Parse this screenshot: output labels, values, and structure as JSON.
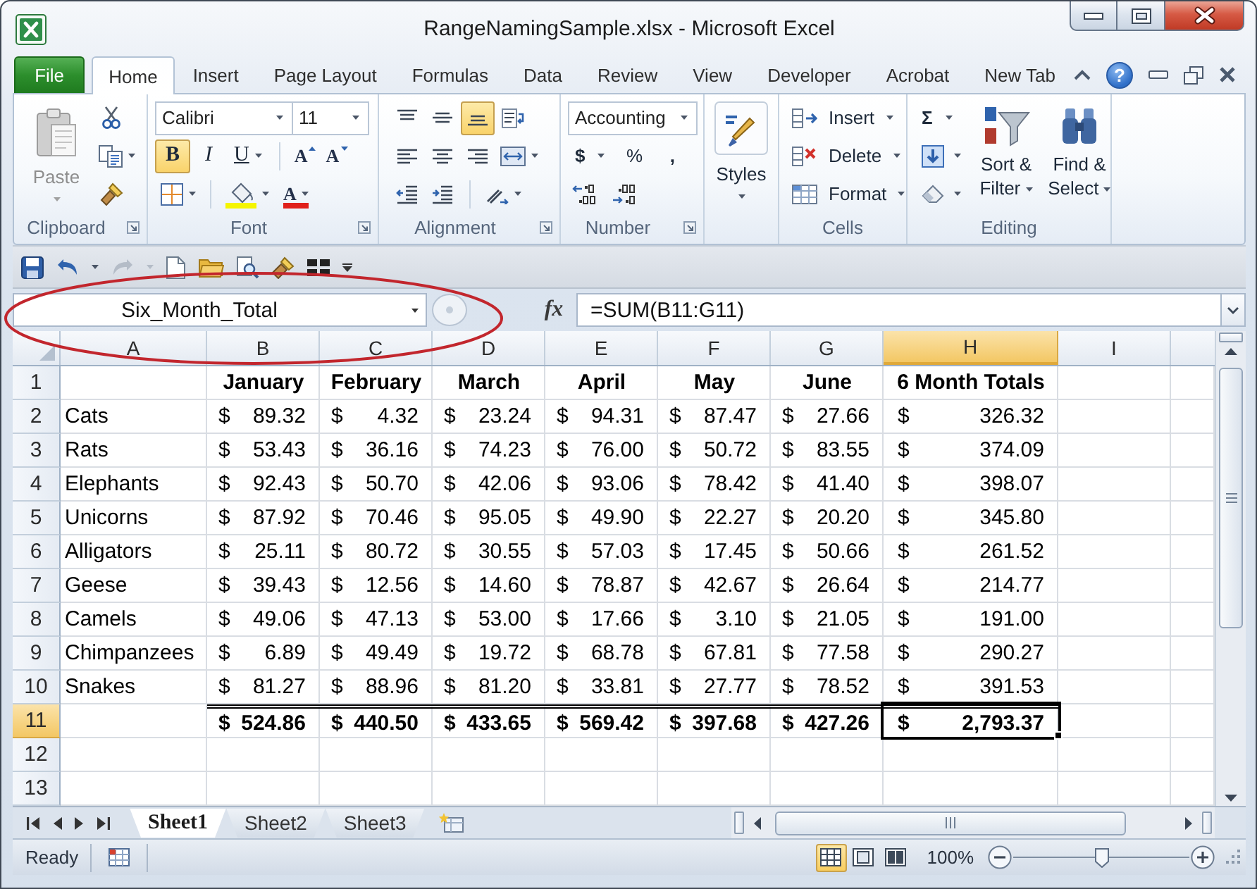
{
  "window": {
    "title": "RangeNamingSample.xlsx - Microsoft Excel"
  },
  "ribbon_tabs": [
    {
      "label": "File",
      "kind": "file",
      "selected": false
    },
    {
      "label": "Home",
      "kind": "tab",
      "selected": true
    },
    {
      "label": "Insert",
      "kind": "tab",
      "selected": false
    },
    {
      "label": "Page Layout",
      "kind": "tab",
      "selected": false
    },
    {
      "label": "Formulas",
      "kind": "tab",
      "selected": false
    },
    {
      "label": "Data",
      "kind": "tab",
      "selected": false
    },
    {
      "label": "Review",
      "kind": "tab",
      "selected": false
    },
    {
      "label": "View",
      "kind": "tab",
      "selected": false
    },
    {
      "label": "Developer",
      "kind": "tab",
      "selected": false
    },
    {
      "label": "Acrobat",
      "kind": "tab",
      "selected": false
    },
    {
      "label": "New Tab",
      "kind": "tab",
      "selected": false
    }
  ],
  "help": "?",
  "ribbon": {
    "clipboard": {
      "paste": {
        "label": "Paste",
        "disabled": true
      },
      "label": "Clipboard"
    },
    "font": {
      "name": "Calibri",
      "size": "11",
      "styles": [
        {
          "kind": "bold",
          "label": "B",
          "on": true
        },
        {
          "kind": "italic",
          "label": "I",
          "on": false
        },
        {
          "kind": "underline",
          "label": "U",
          "on": false
        }
      ],
      "grow": "A",
      "shrink": "A",
      "font_color": "A",
      "label": "Font"
    },
    "alignment": {
      "vertical": [
        {
          "kind": "top",
          "on": false
        },
        {
          "kind": "middle",
          "on": false
        },
        {
          "kind": "bottom",
          "on": true
        }
      ],
      "label": "Alignment"
    },
    "number": {
      "format": "Accounting",
      "currency": "$",
      "percent": "%",
      "comma": ",",
      "label": "Number"
    },
    "styles": {
      "button": "Styles"
    },
    "cells": {
      "buttons": [
        {
          "kind": "insert",
          "label": "Insert"
        },
        {
          "kind": "delete",
          "label": "Delete"
        },
        {
          "kind": "format",
          "label": "Format"
        }
      ],
      "label": "Cells"
    },
    "editing": {
      "autosum": "Σ",
      "sort": "Sort & Filter",
      "find": "Find & Select",
      "label": "Editing"
    }
  },
  "quick_access": {
    "redo": {
      "disabled": true
    }
  },
  "formula_bar": {
    "name_box": "Six_Month_Total",
    "function_label": "fx",
    "formula": "=SUM(B11:G11)"
  },
  "sheet": {
    "columns": [
      {
        "label": "A",
        "selected": false
      },
      {
        "label": "B",
        "selected": false
      },
      {
        "label": "C",
        "selected": false
      },
      {
        "label": "D",
        "selected": false
      },
      {
        "label": "E",
        "selected": false
      },
      {
        "label": "F",
        "selected": false
      },
      {
        "label": "G",
        "selected": false
      },
      {
        "label": "H",
        "selected": true
      },
      {
        "label": "I",
        "selected": false
      }
    ],
    "rows": [
      {
        "kind": "header",
        "number": "1",
        "selected": false,
        "months": [
          "January",
          "February",
          "March",
          "April",
          "May",
          "June"
        ],
        "total": "6 Month Totals"
      },
      {
        "kind": "data",
        "number": "2",
        "selected": false,
        "name": "Cats",
        "amounts": [
          {
            "sign": "$",
            "amount": "89.32"
          },
          {
            "sign": "$",
            "amount": "4.32"
          },
          {
            "sign": "$",
            "amount": "23.24"
          },
          {
            "sign": "$",
            "amount": "94.31"
          },
          {
            "sign": "$",
            "amount": "87.47"
          },
          {
            "sign": "$",
            "amount": "27.66"
          },
          {
            "sign": "$",
            "amount": "326.32"
          }
        ]
      },
      {
        "kind": "data",
        "number": "3",
        "selected": false,
        "name": "Rats",
        "amounts": [
          {
            "sign": "$",
            "amount": "53.43"
          },
          {
            "sign": "$",
            "amount": "36.16"
          },
          {
            "sign": "$",
            "amount": "74.23"
          },
          {
            "sign": "$",
            "amount": "76.00"
          },
          {
            "sign": "$",
            "amount": "50.72"
          },
          {
            "sign": "$",
            "amount": "83.55"
          },
          {
            "sign": "$",
            "amount": "374.09"
          }
        ]
      },
      {
        "kind": "data",
        "number": "4",
        "selected": false,
        "name": "Elephants",
        "amounts": [
          {
            "sign": "$",
            "amount": "92.43"
          },
          {
            "sign": "$",
            "amount": "50.70"
          },
          {
            "sign": "$",
            "amount": "42.06"
          },
          {
            "sign": "$",
            "amount": "93.06"
          },
          {
            "sign": "$",
            "amount": "78.42"
          },
          {
            "sign": "$",
            "amount": "41.40"
          },
          {
            "sign": "$",
            "amount": "398.07"
          }
        ]
      },
      {
        "kind": "data",
        "number": "5",
        "selected": false,
        "name": "Unicorns",
        "amounts": [
          {
            "sign": "$",
            "amount": "87.92"
          },
          {
            "sign": "$",
            "amount": "70.46"
          },
          {
            "sign": "$",
            "amount": "95.05"
          },
          {
            "sign": "$",
            "amount": "49.90"
          },
          {
            "sign": "$",
            "amount": "22.27"
          },
          {
            "sign": "$",
            "amount": "20.20"
          },
          {
            "sign": "$",
            "amount": "345.80"
          }
        ]
      },
      {
        "kind": "data",
        "number": "6",
        "selected": false,
        "name": "Alligators",
        "amounts": [
          {
            "sign": "$",
            "amount": "25.11"
          },
          {
            "sign": "$",
            "amount": "80.72"
          },
          {
            "sign": "$",
            "amount": "30.55"
          },
          {
            "sign": "$",
            "amount": "57.03"
          },
          {
            "sign": "$",
            "amount": "17.45"
          },
          {
            "sign": "$",
            "amount": "50.66"
          },
          {
            "sign": "$",
            "amount": "261.52"
          }
        ]
      },
      {
        "kind": "data",
        "number": "7",
        "selected": false,
        "name": "Geese",
        "amounts": [
          {
            "sign": "$",
            "amount": "39.43"
          },
          {
            "sign": "$",
            "amount": "12.56"
          },
          {
            "sign": "$",
            "amount": "14.60"
          },
          {
            "sign": "$",
            "amount": "78.87"
          },
          {
            "sign": "$",
            "amount": "42.67"
          },
          {
            "sign": "$",
            "amount": "26.64"
          },
          {
            "sign": "$",
            "amount": "214.77"
          }
        ]
      },
      {
        "kind": "data",
        "number": "8",
        "selected": false,
        "name": "Camels",
        "amounts": [
          {
            "sign": "$",
            "amount": "49.06"
          },
          {
            "sign": "$",
            "amount": "47.13"
          },
          {
            "sign": "$",
            "amount": "53.00"
          },
          {
            "sign": "$",
            "amount": "17.66"
          },
          {
            "sign": "$",
            "amount": "3.10"
          },
          {
            "sign": "$",
            "amount": "21.05"
          },
          {
            "sign": "$",
            "amount": "191.00"
          }
        ]
      },
      {
        "kind": "data",
        "number": "9",
        "selected": false,
        "name": "Chimpanzees",
        "amounts": [
          {
            "sign": "$",
            "amount": "6.89"
          },
          {
            "sign": "$",
            "amount": "49.49"
          },
          {
            "sign": "$",
            "amount": "19.72"
          },
          {
            "sign": "$",
            "amount": "68.78"
          },
          {
            "sign": "$",
            "amount": "67.81"
          },
          {
            "sign": "$",
            "amount": "77.58"
          },
          {
            "sign": "$",
            "amount": "290.27"
          }
        ]
      },
      {
        "kind": "data",
        "number": "10",
        "selected": false,
        "name": "Snakes",
        "amounts": [
          {
            "sign": "$",
            "amount": "81.27"
          },
          {
            "sign": "$",
            "amount": "88.96"
          },
          {
            "sign": "$",
            "amount": "81.20"
          },
          {
            "sign": "$",
            "amount": "33.81"
          },
          {
            "sign": "$",
            "amount": "27.77"
          },
          {
            "sign": "$",
            "amount": "78.52"
          },
          {
            "sign": "$",
            "amount": "391.53"
          }
        ]
      },
      {
        "kind": "total",
        "number": "11",
        "selected": true,
        "amounts": [
          {
            "sign": "$",
            "amount": "524.86"
          },
          {
            "sign": "$",
            "amount": "440.50"
          },
          {
            "sign": "$",
            "amount": "433.65"
          },
          {
            "sign": "$",
            "amount": "569.42"
          },
          {
            "sign": "$",
            "amount": "397.68"
          },
          {
            "sign": "$",
            "amount": "427.26"
          },
          {
            "sign": "$",
            "amount": "2,793.37"
          }
        ]
      },
      {
        "kind": "empty",
        "number": "12",
        "selected": false
      },
      {
        "kind": "empty",
        "number": "13",
        "selected": false
      }
    ]
  },
  "sheet_tabs": [
    {
      "label": "Sheet1",
      "selected": true
    },
    {
      "label": "Sheet2",
      "selected": false
    },
    {
      "label": "Sheet3",
      "selected": false
    }
  ],
  "status_bar": {
    "mode": "Ready",
    "views": [
      {
        "kind": "normal",
        "selected": true
      },
      {
        "kind": "page_layout",
        "selected": false
      },
      {
        "kind": "page_break",
        "selected": false
      }
    ],
    "zoom": "100%",
    "zoom_slider": {
      "level": 0.5
    }
  }
}
